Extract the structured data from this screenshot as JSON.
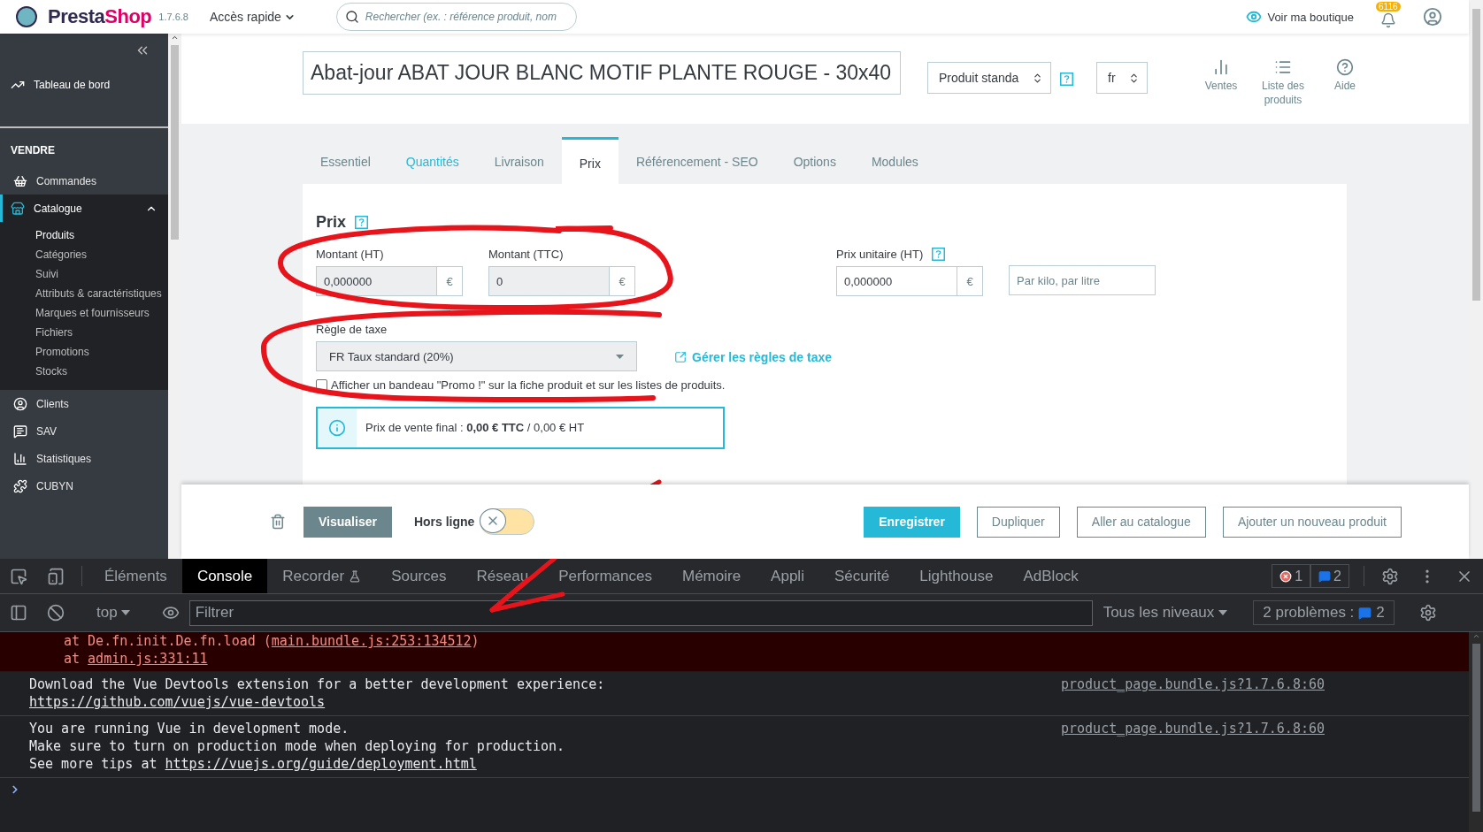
{
  "header": {
    "logo": [
      "Presta",
      "Shop"
    ],
    "version": "1.7.6.8",
    "quick_access": "Accès rapide",
    "search": {
      "placeholder": "Rechercher (ex. : référence produit, nom"
    },
    "shop_link": "Voir ma boutique",
    "notification_count": "6116"
  },
  "sidebar": {
    "dashboard": "Tableau de bord",
    "section": "VENDRE",
    "items": [
      {
        "label": "Commandes",
        "selected": false
      },
      {
        "label": "Catalogue",
        "selected": true,
        "expanded": true,
        "children": [
          {
            "label": "Produits",
            "selected": true
          },
          {
            "label": "Catégories",
            "selected": false
          },
          {
            "label": "Suivi",
            "selected": false
          },
          {
            "label": "Attributs & caractéristiques",
            "selected": false
          },
          {
            "label": "Marques et fournisseurs",
            "selected": false
          },
          {
            "label": "Fichiers",
            "selected": false
          },
          {
            "label": "Promotions",
            "selected": false
          },
          {
            "label": "Stocks",
            "selected": false
          }
        ]
      },
      {
        "label": "Clients",
        "selected": false
      },
      {
        "label": "SAV",
        "selected": false
      },
      {
        "label": "Statistiques",
        "selected": false
      },
      {
        "label": "CUBYN",
        "selected": false
      }
    ]
  },
  "product": {
    "name": "Abat-jour ABAT JOUR BLANC MOTIF PLANTE ROUGE - 30x40",
    "type": "Produit standa",
    "language": "fr",
    "actions": [
      "Ventes",
      "Liste des produits",
      "Aide"
    ]
  },
  "tabs": [
    {
      "label": "Essentiel",
      "selected": false,
      "highlighted": false
    },
    {
      "label": "Quantités",
      "selected": false,
      "highlighted": true
    },
    {
      "label": "Livraison",
      "selected": false,
      "highlighted": false
    },
    {
      "label": "Prix",
      "selected": true,
      "highlighted": false
    },
    {
      "label": "Référencement - SEO",
      "selected": false,
      "highlighted": false
    },
    {
      "label": "Options",
      "selected": false,
      "highlighted": false
    },
    {
      "label": "Modules",
      "selected": false,
      "highlighted": false
    }
  ],
  "price_form": {
    "title": "Prix",
    "fields": [
      {
        "label": "Montant (HT)",
        "value": "0,000000",
        "addon": "€",
        "disabled": true
      },
      {
        "label": "Montant (TTC)",
        "value": "0",
        "addon": "€",
        "disabled": true
      }
    ],
    "unit_price": {
      "label": "Prix unitaire (HT)",
      "value": "0,000000",
      "addon": "€",
      "disabled": false,
      "unit_placeholder": "Par kilo, par litre"
    },
    "tax_rule": {
      "label": "Règle de taxe",
      "value": "FR Taux standard (20%)"
    },
    "tax_link": "Gérer les règles de taxe",
    "promo": {
      "label": "Afficher un bandeau \"Promo !\" sur la fiche produit et sur les listes de produits.",
      "checked": false
    },
    "final_price": "Prix de vente final : **0,00 € TTC** / 0,00 € HT"
  },
  "footer": {
    "preview": "Visualiser",
    "offline": {
      "label": "Hors ligne",
      "on": false
    },
    "buttons": [
      {
        "label": "Enregistrer",
        "primary": true
      },
      {
        "label": "Dupliquer",
        "primary": false
      },
      {
        "label": "Aller au catalogue",
        "primary": false
      },
      {
        "label": "Ajouter un nouveau produit",
        "primary": false
      }
    ]
  },
  "devtools": {
    "tabs": [
      {
        "label": "Éléments",
        "selected": false
      },
      {
        "label": "Console",
        "selected": true
      },
      {
        "label": "Recorder",
        "selected": false
      },
      {
        "label": "Sources",
        "selected": false
      },
      {
        "label": "Réseau",
        "selected": false
      },
      {
        "label": "Performances",
        "selected": false
      },
      {
        "label": "Mémoire",
        "selected": false
      },
      {
        "label": "Appli",
        "selected": false
      },
      {
        "label": "Sécurité",
        "selected": false
      },
      {
        "label": "Lighthouse",
        "selected": false
      },
      {
        "label": "AdBlock",
        "selected": false
      }
    ],
    "error_count": "1",
    "message_count": "2",
    "context": "top",
    "filter": {
      "placeholder": "Filtrer"
    },
    "levels": "Tous les niveaux",
    "issues": {
      "label": "2 problèmes :",
      "count": "2"
    },
    "messages": [
      {
        "kind": "error",
        "lines": [
          {
            "text": "at De.fn.init.De.fn.load (",
            "link": "main.bundle.js:253:134512",
            "after": ")"
          },
          {
            "text": "at ",
            "link": "admin.js:331:11"
          }
        ]
      },
      {
        "kind": "info",
        "source": "product_page.bundle.js?1.7.6.8:60",
        "lines": [
          {
            "text": "Download the Vue Devtools extension for a better development experience:"
          },
          {
            "link": "https://github.com/vuejs/vue-devtools"
          }
        ]
      },
      {
        "kind": "info",
        "source": "product_page.bundle.js?1.7.6.8:60",
        "lines": [
          {
            "text": "You are running Vue in development mode."
          },
          {
            "text": "Make sure to turn on production mode when deploying for production."
          },
          {
            "text": "See more tips at ",
            "link": "https://vuejs.org/guide/deployment.html"
          }
        ]
      }
    ]
  }
}
